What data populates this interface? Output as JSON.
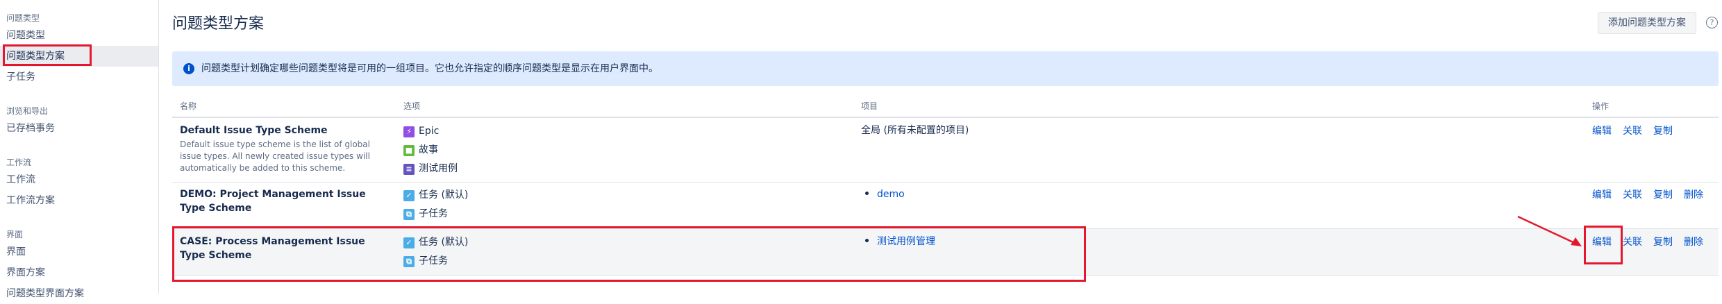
{
  "sidebar": {
    "sections": [
      {
        "heading": "问题类型",
        "items": [
          "问题类型",
          "问题类型方案",
          "子任务"
        ]
      },
      {
        "heading": "浏览和导出",
        "items": [
          "已存档事务"
        ]
      },
      {
        "heading": "工作流",
        "items": [
          "工作流",
          "工作流方案"
        ]
      },
      {
        "heading": "界面",
        "items": [
          "界面",
          "界面方案",
          "问题类型界面方案"
        ]
      }
    ],
    "active_item": "问题类型方案"
  },
  "header": {
    "title": "问题类型方案",
    "add_button": "添加问题类型方案",
    "help_icon": "?"
  },
  "info": {
    "icon": "i",
    "text": "问题类型计划确定哪些问题类型将是可用的一组项目。它也允许指定的顺序问题类型是显示在用户界面中。"
  },
  "table": {
    "columns": {
      "name": "名称",
      "options": "选项",
      "projects": "项目",
      "actions": "操作"
    },
    "rows": [
      {
        "name": "Default Issue Type Scheme",
        "description": "Default issue type scheme is the list of global issue types. All newly created issue types will automatically be added to this scheme.",
        "options": [
          {
            "icon": "epic-icon",
            "glyph": "⚡",
            "label": "Epic"
          },
          {
            "icon": "story-icon",
            "glyph": "■",
            "label": "故事"
          },
          {
            "icon": "test-case-icon",
            "glyph": "≡",
            "label": "测试用例"
          }
        ],
        "project_text": "全局 (所有未配置的项目)",
        "actions": [
          "编辑",
          "关联",
          "复制"
        ]
      },
      {
        "name": "DEMO: Project Management Issue Type Scheme",
        "options": [
          {
            "icon": "task-icon",
            "glyph": "✓",
            "label": "任务 (默认)"
          },
          {
            "icon": "subtask-icon",
            "glyph": "⧉",
            "label": "子任务"
          }
        ],
        "project_link": "demo",
        "actions": [
          "编辑",
          "关联",
          "复制",
          "删除"
        ]
      },
      {
        "name": "CASE: Process Management Issue Type Scheme",
        "options": [
          {
            "icon": "task-icon",
            "glyph": "✓",
            "label": "任务 (默认)"
          },
          {
            "icon": "subtask-icon",
            "glyph": "⧉",
            "label": "子任务"
          }
        ],
        "project_link": "测试用例管理",
        "actions": [
          "编辑",
          "关联",
          "复制",
          "删除"
        ]
      }
    ]
  },
  "colors": {
    "link": "#0052cc",
    "info_bg": "#deebff",
    "annotation": "#e3182e",
    "active_bg": "#ebecf0"
  }
}
